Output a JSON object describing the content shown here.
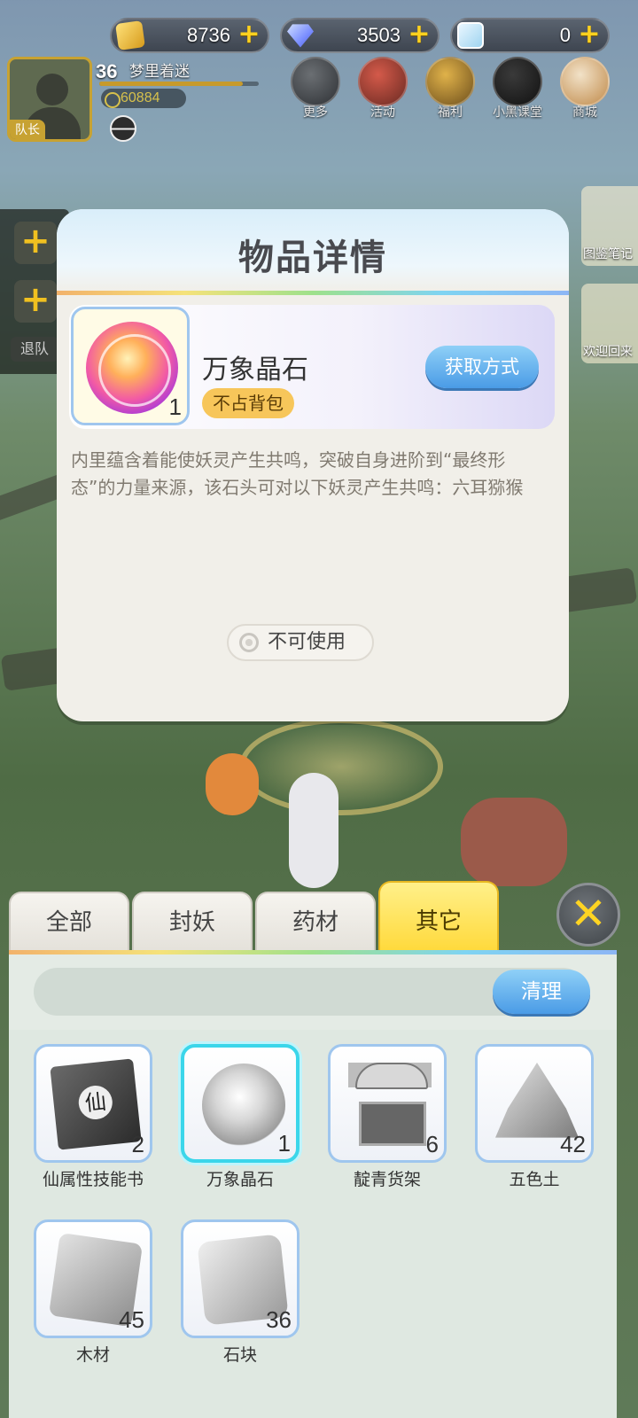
{
  "currencies": [
    {
      "icon": "gold-crystal-icon",
      "value": "8736",
      "plus": "+"
    },
    {
      "icon": "diamond-icon",
      "value": "3503",
      "plus": "+"
    },
    {
      "icon": "ticket-icon",
      "value": "0",
      "plus": "+"
    }
  ],
  "player": {
    "level": "36",
    "name": "梦里着迷",
    "power": "60884",
    "role_badge": "队长"
  },
  "top_menu": [
    "更多",
    "活动",
    "福利",
    "小黑课堂",
    "商城"
  ],
  "side": {
    "add1": "+",
    "add2": "+",
    "quit": "退队"
  },
  "right_side": [
    "图鉴笔记",
    "欢迎回来"
  ],
  "modal": {
    "title": "物品详情",
    "item": {
      "name": "万象晶石",
      "count": "1",
      "tag": "不占背包",
      "obtain_button": "获取方式",
      "description": "内里蕴含着能使妖灵产生共鸣，突破自身进阶到“最终形态”的力量来源，该石头可对以下妖灵产生共鸣：六耳猕猴",
      "status": "不可使用"
    }
  },
  "bag": {
    "tabs": [
      "全部",
      "封妖",
      "药材",
      "其它"
    ],
    "active_tab": "其它",
    "close": "✕",
    "clean_button": "清理",
    "items": [
      {
        "name": "仙属性技能书",
        "count": "2",
        "art": "skill-book-icon"
      },
      {
        "name": "万象晶石",
        "count": "1",
        "art": "crystal-orb-icon",
        "selected": true
      },
      {
        "name": "靛青货架",
        "count": "6",
        "art": "market-stall-icon"
      },
      {
        "name": "五色土",
        "count": "42",
        "art": "soil-pile-icon"
      },
      {
        "name": "木材",
        "count": "45",
        "art": "wood-block-icon"
      },
      {
        "name": "石块",
        "count": "36",
        "art": "stone-block-icon"
      }
    ]
  }
}
